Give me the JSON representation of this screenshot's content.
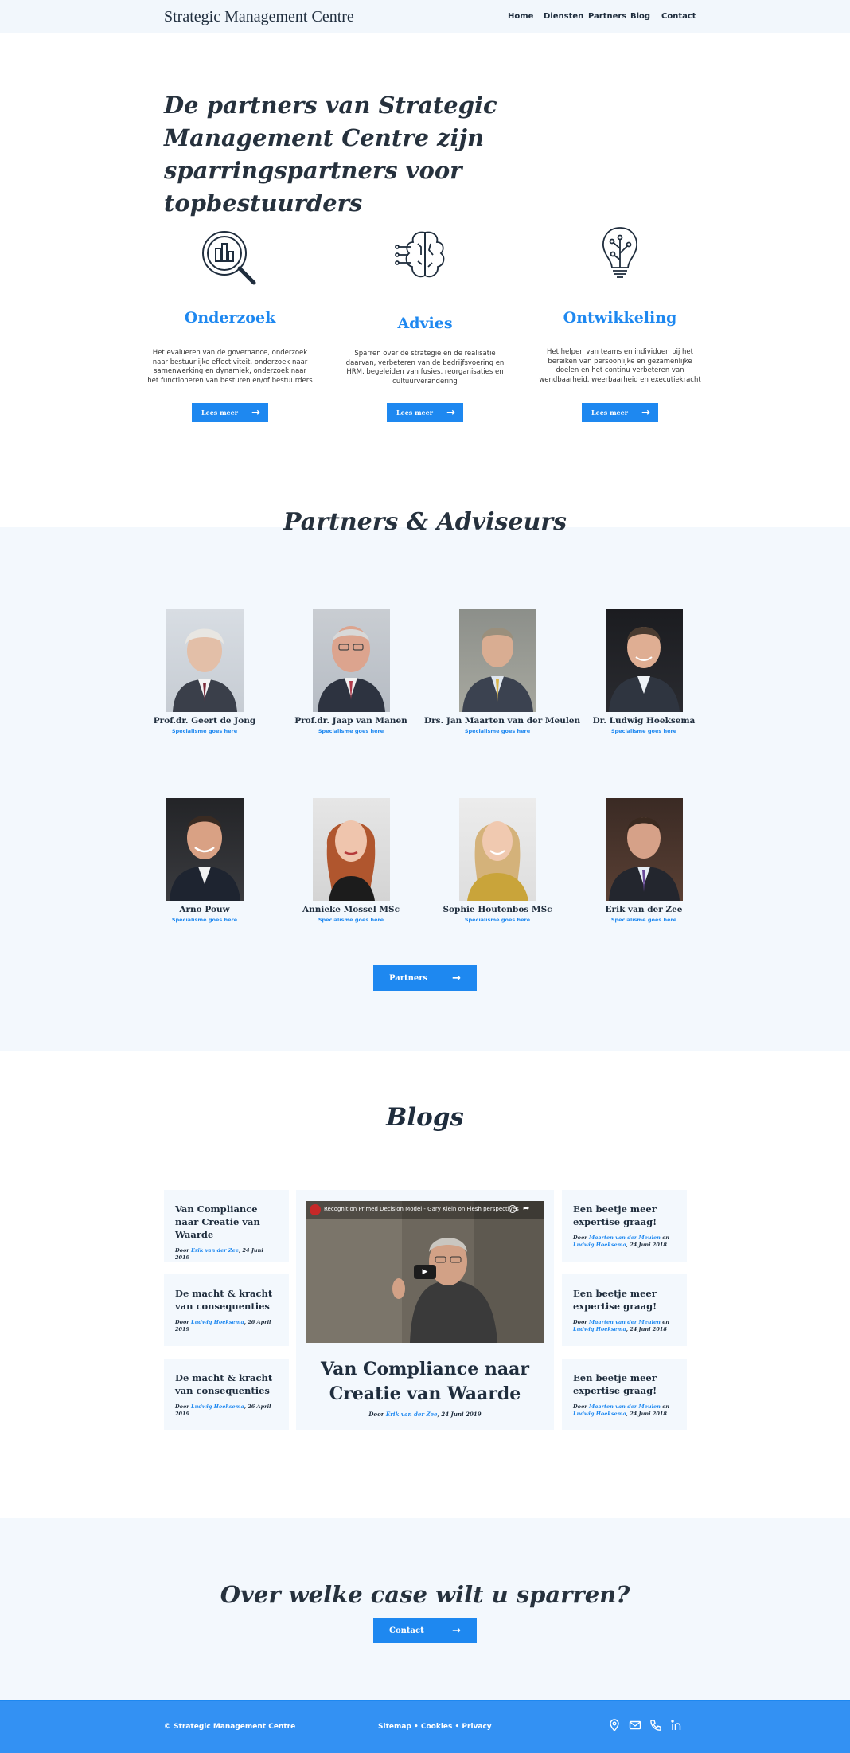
{
  "header": {
    "brand": "Strategic Management Centre",
    "nav": [
      "Home",
      "Diensten",
      "Partners",
      "Blog",
      "Contact"
    ]
  },
  "hero": {
    "title": "De partners van Strategic Management Centre zijn sparringspartners voor topbestuurders"
  },
  "services": [
    {
      "title": "Onderzoek",
      "icon": "magnifier-chart-icon",
      "description": "Het evalueren van de governance, onderzoek naar bestuurlijke effectiviteit, onderzoek naar samenwerking en dynamiek, onderzoek naar het functioneren van besturen en/of bestuurders",
      "button": "Lees meer"
    },
    {
      "title": "Advies",
      "icon": "brain-circuit-icon",
      "description": "Sparren over de strategie en de realisatie daarvan, verbeteren van de bedrijfsvoering en HRM, begeleiden van fusies, reorganisaties en cultuurverandering",
      "button": "Lees meer"
    },
    {
      "title": "Ontwikkeling",
      "icon": "lightbulb-icon",
      "description": "Het helpen van teams en individuen bij het bereiken van persoonlijke en gezamenlijke doelen en het continu verbeteren van wendbaarheid, weerbaarheid en executiekracht",
      "button": "Lees meer"
    }
  ],
  "partners": {
    "title": "Partners & Adviseurs",
    "button": "Partners",
    "people": [
      {
        "name": "Prof.dr. Geert de Jong",
        "spec": "Specialisme goes here"
      },
      {
        "name": "Prof.dr. Jaap van Manen",
        "spec": "Specialisme goes here"
      },
      {
        "name": "Drs. Jan Maarten van der Meulen",
        "spec": "Specialisme goes here"
      },
      {
        "name": "Dr. Ludwig Hoeksema",
        "spec": "Specialisme goes here"
      },
      {
        "name": "Arno Pouw",
        "spec": "Specialisme goes here"
      },
      {
        "name": "Annieke Mossel MSc",
        "spec": "Specialisme goes here"
      },
      {
        "name": "Sophie Houtenbos MSc",
        "spec": "Specialisme goes here"
      },
      {
        "name": "Erik van der Zee",
        "spec": "Specialisme goes here"
      }
    ]
  },
  "blogs": {
    "title": "Blogs",
    "left": [
      {
        "title": "Van Compliance naar Creatie van Waarde",
        "by": "Door",
        "author": "Erik van der Zee",
        "author2": "",
        "date": ", 24 Juni 2019"
      },
      {
        "title": "De macht & kracht van consequenties",
        "by": "Door",
        "author": "Ludwig Hoeksema",
        "author2": "",
        "date": ", 26 April 2019"
      },
      {
        "title": "De macht & kracht van consequenties",
        "by": "Door",
        "author": "Ludwig Hoeksema",
        "author2": "",
        "date": ", 26 April 2019"
      }
    ],
    "right": [
      {
        "title": "Een beetje meer expertise graag!",
        "by": "Door",
        "author": "Maarten van der Meulen",
        "and": " en ",
        "author2": "Ludwig Hoeksema",
        "date": ", 24 Juni 2018"
      },
      {
        "title": "Een beetje meer expertise graag!",
        "by": "Door",
        "author": "Maarten van der Meulen",
        "and": " en ",
        "author2": "Ludwig Hoeksema",
        "date": ", 24 Juni 2018"
      },
      {
        "title": "Een beetje meer expertise graag!",
        "by": "Door",
        "author": "Maarten van der Meulen",
        "and": " en ",
        "author2": "Ludwig Hoeksema",
        "date": ", 24 Juni 2018"
      }
    ],
    "featured": {
      "video_title": "Recognition Primed Decision Model - Gary Klein on Flesh perspectives",
      "title": "Van Compliance naar Creatie van Waarde",
      "by": "Door",
      "author": "Erik van der Zee",
      "date": ", 24 Juni 2019"
    }
  },
  "cta": {
    "title": "Over welke case wilt u sparren?",
    "button": "Contact"
  },
  "footer": {
    "copyright": "© Strategic Management Centre",
    "links": "Sitemap • Cookies  • Privacy",
    "icons": [
      "location-icon",
      "mail-icon",
      "phone-icon",
      "linkedin-icon"
    ]
  },
  "colors": {
    "accent": "#1e88f0",
    "light_bg": "#f3f8fd",
    "text": "#1f2d3d",
    "footer": "#3391f3"
  }
}
